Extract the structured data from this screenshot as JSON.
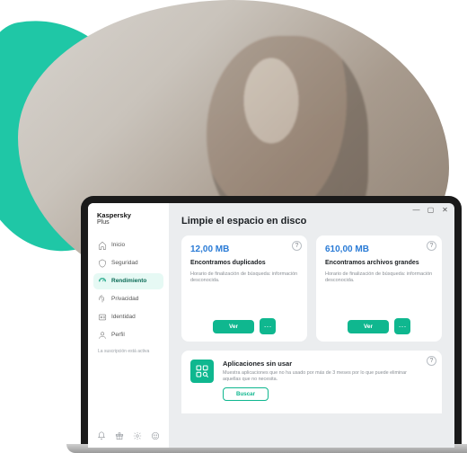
{
  "brand": {
    "name": "Kaspersky",
    "product": "Plus"
  },
  "window_controls": {
    "minimize": "—",
    "maximize": "▢",
    "close": "✕"
  },
  "sidebar": {
    "items": [
      {
        "label": "Inicio"
      },
      {
        "label": "Seguridad"
      },
      {
        "label": "Rendimiento"
      },
      {
        "label": "Privacidad"
      },
      {
        "label": "Identidad"
      },
      {
        "label": "Perfil"
      }
    ],
    "profile_note": "La suscripción está activa"
  },
  "page": {
    "title": "Limpie el espacio en disco"
  },
  "cards": {
    "duplicates": {
      "stat": "12,00 MB",
      "title": "Encontramos duplicados",
      "subtitle": "Horario de finalización de búsqueda: información desconocida.",
      "action": "Ver",
      "more": "···"
    },
    "large": {
      "stat": "610,00 MB",
      "title": "Encontramos archivos grandes",
      "subtitle": "Horario de finalización de búsqueda: información desconocida.",
      "action": "Ver",
      "more": "···"
    }
  },
  "unused": {
    "title": "Aplicaciones sin usar",
    "subtitle": "Muestra aplicaciones que no ha usado por más de 3 meses por lo que puede eliminar aquellas que no necesita.",
    "action": "Buscar"
  },
  "help_glyph": "?"
}
